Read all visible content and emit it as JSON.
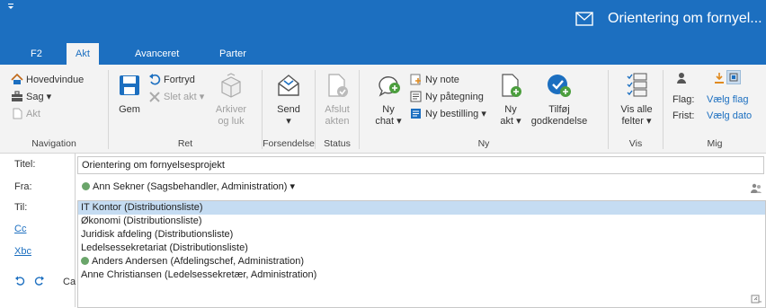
{
  "window": {
    "title": "Orientering om fornyel...",
    "qat_icon": "dropdown-arrow"
  },
  "tabs": [
    {
      "label": "F2",
      "active": false
    },
    {
      "label": "Akt",
      "active": true
    },
    {
      "label": "Avanceret",
      "active": false
    },
    {
      "label": "Parter",
      "active": false
    }
  ],
  "ribbon": {
    "navigation": {
      "label": "Navigation",
      "hovedvindue": "Hovedvindue",
      "sag": "Sag ▾",
      "akt": "Akt"
    },
    "ret": {
      "label": "Ret",
      "gem": "Gem",
      "fortryd": "Fortryd",
      "slet_akt": "Slet akt ▾",
      "arkiver_line1": "Arkiver",
      "arkiver_line2": "og luk"
    },
    "forsendelse": {
      "label": "Forsendelse",
      "send": "Send",
      "send_arrow": "▾"
    },
    "status": {
      "label": "Status",
      "afslut_line1": "Afslut",
      "afslut_line2": "akten"
    },
    "ny": {
      "label": "Ny",
      "ny_chat_line1": "Ny",
      "ny_chat_line2": "chat ▾",
      "ny_note": "Ny note",
      "ny_paategning": "Ny påtegning",
      "ny_bestilling": "Ny bestilling ▾",
      "ny_akt_line1": "Ny",
      "ny_akt_line2": "akt ▾",
      "tilfoej_line1": "Tilføj",
      "tilfoej_line2": "godkendelse"
    },
    "vis": {
      "label": "Vis",
      "vis_alle_line1": "Vis alle",
      "vis_alle_line2": "felter ▾"
    },
    "mig": {
      "label": "Mig",
      "flag": "Flag:",
      "frist": "Frist:",
      "vaelg_flag": "Vælg flag",
      "vaelg_dato": "Vælg dato"
    }
  },
  "form": {
    "titel_label": "Titel:",
    "titel_value": "Orientering om fornyelsesprojekt",
    "fra_label": "Fra:",
    "fra_value": "Ann Sekner (Sagsbehandler, Administration)",
    "fra_arrow": "▾",
    "til_label": "Til:",
    "cc_label": "Cc",
    "xbc_label": "Xbc",
    "partial_text": "Ca",
    "suggestions": [
      {
        "text": "IT Kontor (Distributionsliste)",
        "selected": true,
        "dot": false
      },
      {
        "text": "Økonomi (Distributionsliste)",
        "selected": false,
        "dot": false
      },
      {
        "text": "Juridisk afdeling (Distributionsliste)",
        "selected": false,
        "dot": false
      },
      {
        "text": "Ledelsessekretariat (Distributionsliste)",
        "selected": false,
        "dot": false
      },
      {
        "text": "Anders Andersen (Afdelingschef, Administration)",
        "selected": false,
        "dot": true
      },
      {
        "text": "Anne Christiansen (Ledelsessekretær, Administration)",
        "selected": false,
        "dot": false
      }
    ]
  },
  "colors": {
    "accent": "#1c6fc0",
    "ribbon_bg": "#f3f3f3",
    "selected_row": "#c5dcf2",
    "status_dot": "#6aa56a"
  }
}
